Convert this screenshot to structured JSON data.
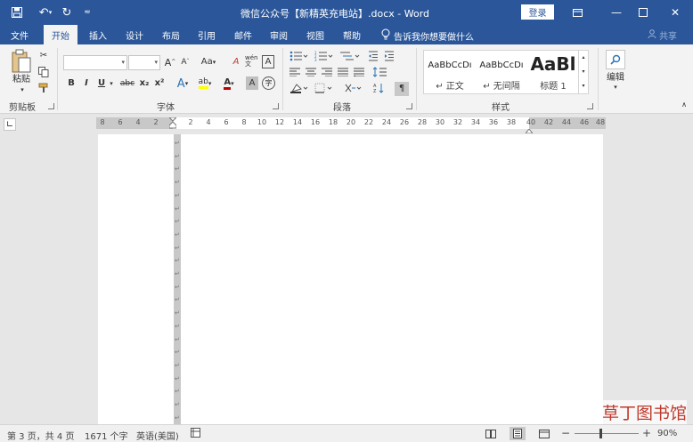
{
  "titlebar": {
    "title": "微信公众号【新精英充电站】.docx  -  Word",
    "login": "登录",
    "qa_save": "save-icon",
    "qa_undo": "undo-icon",
    "qa_redo": "redo-icon"
  },
  "tabs": [
    "文件",
    "开始",
    "插入",
    "设计",
    "布局",
    "引用",
    "邮件",
    "审阅",
    "视图",
    "帮助"
  ],
  "active_tab": "开始",
  "tell_me": "告诉我你想要做什么",
  "share": "共享",
  "ribbon": {
    "clipboard": {
      "label": "剪贴板",
      "paste": "粘贴"
    },
    "font": {
      "label": "字体",
      "bold": "B",
      "italic": "I",
      "underline": "U",
      "strike": "abc",
      "sub": "x₂",
      "sup": "x²",
      "grow": "A",
      "shrink": "A",
      "case": "Aa",
      "clear": "A",
      "phonetic": "wén 文",
      "border_char": "A",
      "font_color": "A",
      "shading": "A",
      "enclose": "字",
      "effects": "A",
      "highlight": "ab"
    },
    "paragraph": {
      "label": "段落"
    },
    "styles": {
      "label": "样式",
      "items": [
        {
          "preview": "AaBbCcDı",
          "name": "↵ 正文"
        },
        {
          "preview": "AaBbCcDı",
          "name": "↵ 无间隔"
        },
        {
          "preview": "AaBl",
          "name": "标题 1"
        }
      ]
    },
    "editing": {
      "label": "编辑"
    }
  },
  "ruler": {
    "left_numbers": [
      "8",
      "6",
      "4",
      "2"
    ],
    "right_numbers": [
      "2",
      "4",
      "6",
      "8",
      "10",
      "12",
      "14",
      "16",
      "18",
      "20",
      "22",
      "24",
      "26",
      "28",
      "30",
      "32",
      "34",
      "36",
      "38",
      "40",
      "42",
      "44",
      "46",
      "48"
    ]
  },
  "status": {
    "page": "第 3 页，共 4 页",
    "words": "1671 个字",
    "language": "英语(美国)",
    "zoom": "90%",
    "zoom_minus": "−",
    "zoom_plus": "+"
  },
  "watermark": "草丁图书馆"
}
